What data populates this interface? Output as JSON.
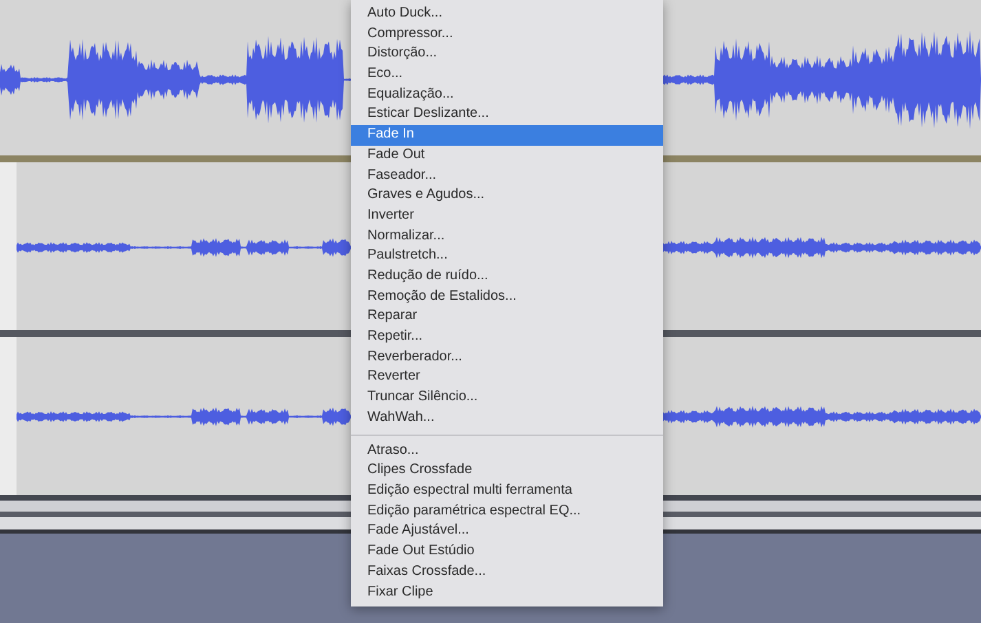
{
  "menu": {
    "items": [
      {
        "kind": "item",
        "label": "Auto Duck...",
        "selected": false
      },
      {
        "kind": "item",
        "label": "Compressor...",
        "selected": false
      },
      {
        "kind": "item",
        "label": "Distorção...",
        "selected": false
      },
      {
        "kind": "item",
        "label": "Eco...",
        "selected": false
      },
      {
        "kind": "item",
        "label": "Equalização...",
        "selected": false
      },
      {
        "kind": "item",
        "label": "Esticar Deslizante...",
        "selected": false
      },
      {
        "kind": "item",
        "label": "Fade In",
        "selected": true
      },
      {
        "kind": "item",
        "label": "Fade Out",
        "selected": false
      },
      {
        "kind": "item",
        "label": "Faseador...",
        "selected": false
      },
      {
        "kind": "item",
        "label": "Graves e Agudos...",
        "selected": false
      },
      {
        "kind": "item",
        "label": "Inverter",
        "selected": false
      },
      {
        "kind": "item",
        "label": "Normalizar...",
        "selected": false
      },
      {
        "kind": "item",
        "label": "Paulstretch...",
        "selected": false
      },
      {
        "kind": "item",
        "label": "Redução de ruído...",
        "selected": false
      },
      {
        "kind": "item",
        "label": "Remoção de Estalidos...",
        "selected": false
      },
      {
        "kind": "item",
        "label": "Reparar",
        "selected": false
      },
      {
        "kind": "item",
        "label": "Repetir...",
        "selected": false
      },
      {
        "kind": "item",
        "label": "Reverberador...",
        "selected": false
      },
      {
        "kind": "item",
        "label": "Reverter",
        "selected": false
      },
      {
        "kind": "item",
        "label": "Truncar Silêncio...",
        "selected": false
      },
      {
        "kind": "item",
        "label": "WahWah...",
        "selected": false
      },
      {
        "kind": "separator"
      },
      {
        "kind": "item",
        "label": "Atraso...",
        "selected": false
      },
      {
        "kind": "item",
        "label": "Clipes Crossfade",
        "selected": false
      },
      {
        "kind": "item",
        "label": "Edição espectral multi ferramenta",
        "selected": false
      },
      {
        "kind": "item",
        "label": "Edição paramétrica espectral EQ...",
        "selected": false
      },
      {
        "kind": "item",
        "label": "Fade Ajustável...",
        "selected": false
      },
      {
        "kind": "item",
        "label": "Fade Out Estúdio",
        "selected": false
      },
      {
        "kind": "item",
        "label": "Faixas Crossfade...",
        "selected": false
      },
      {
        "kind": "item",
        "label": "Fixar Clipe",
        "selected": false
      }
    ]
  }
}
